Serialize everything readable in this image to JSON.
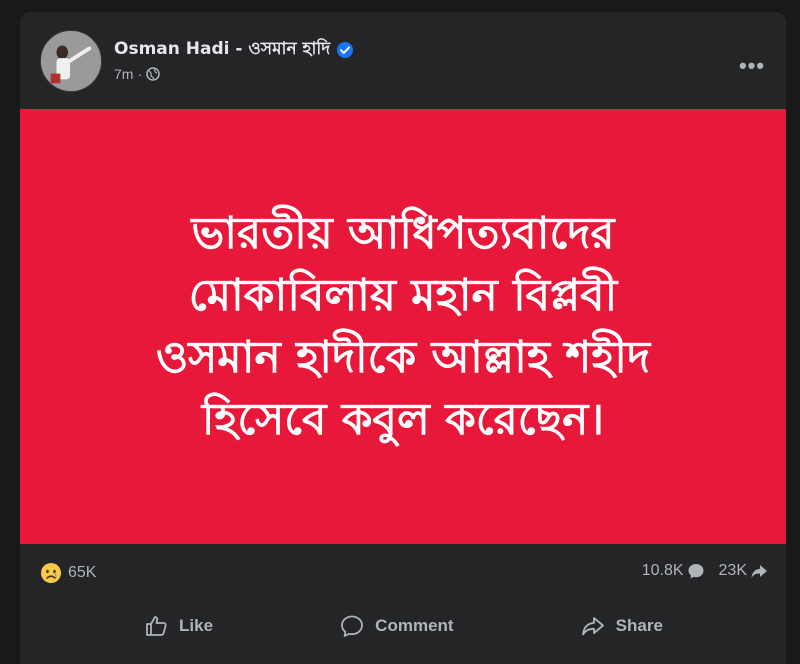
{
  "post": {
    "author": "Osman Hadi - ওসমান হাদি",
    "time": "7m",
    "separator": "·",
    "more_label": "•••",
    "image_text": "ভারতীয় আধিপত্যবাদের\nমোকাবিলায় মহান বিপ্লবী\nওসমান হাদীকে আল্লাহ শহীদ\nহিসেবে কবুল করেছেন।",
    "colors": {
      "background": "#242526",
      "image_background": "#e8183a",
      "verified": "#1877f2",
      "text_secondary": "#b0b3b8"
    }
  },
  "stats": {
    "reactions": "65K",
    "reaction_icon": "sad-face-icon",
    "comments": "10.8K",
    "shares": "23K"
  },
  "actions": {
    "like": "Like",
    "comment": "Comment",
    "share": "Share"
  }
}
